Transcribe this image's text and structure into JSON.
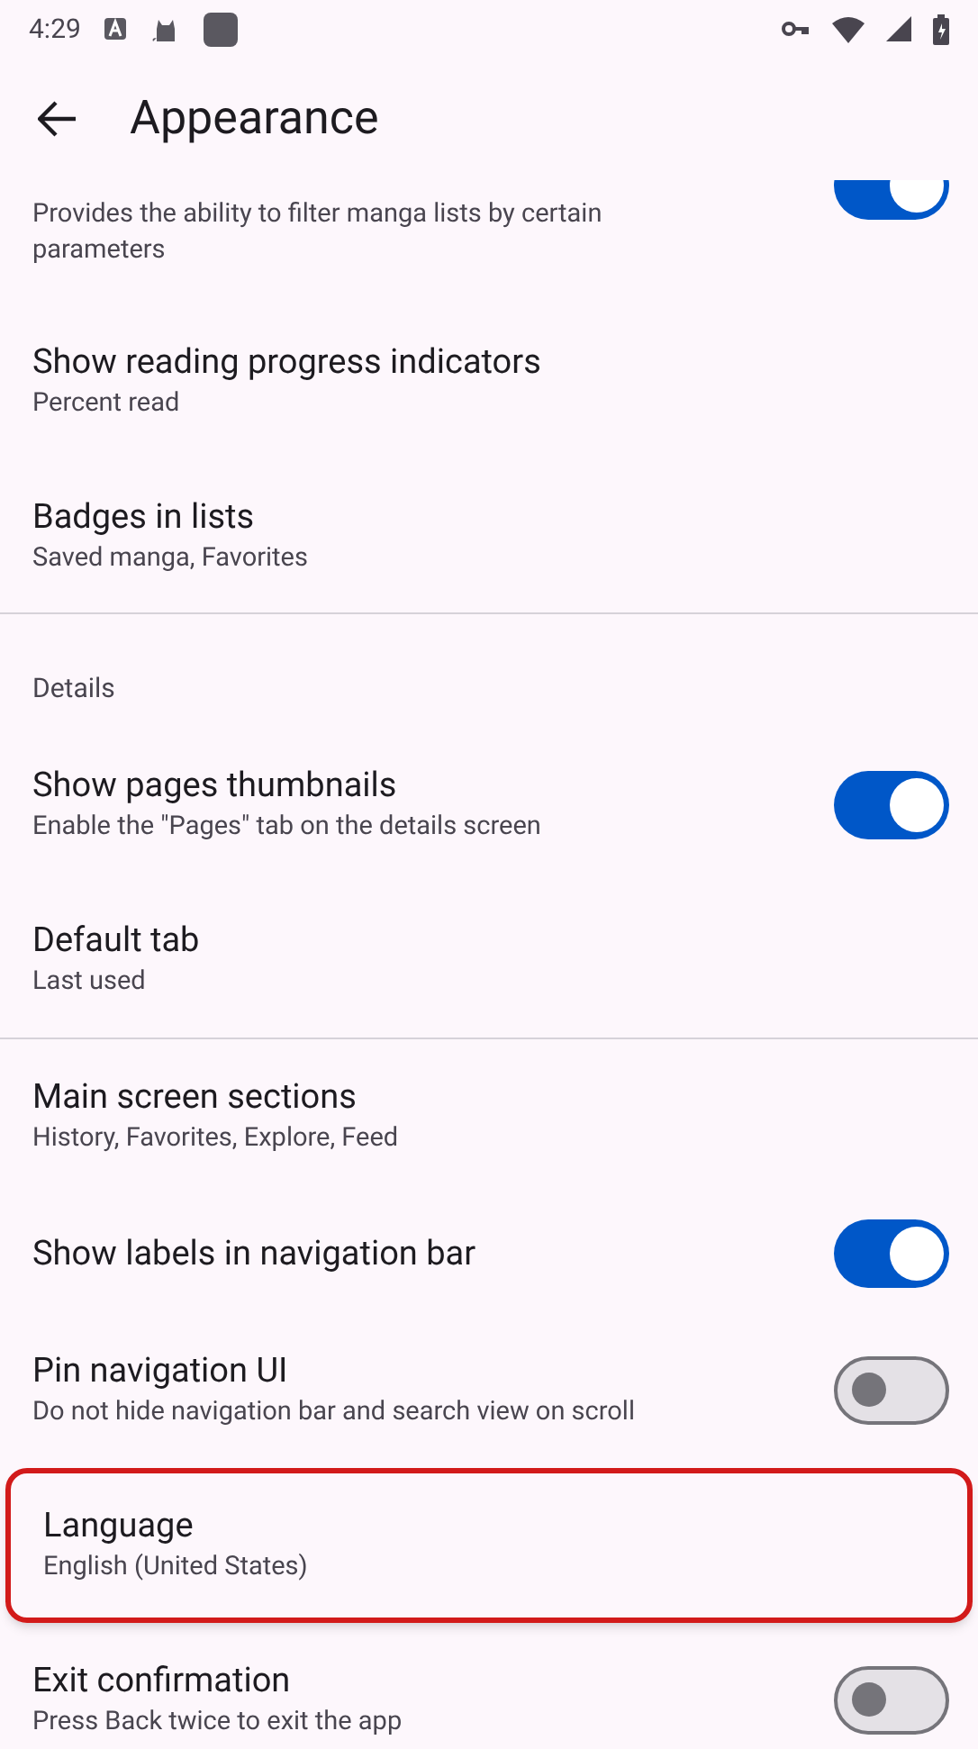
{
  "status_bar": {
    "time": "4:29"
  },
  "app_bar": {
    "title": "Appearance"
  },
  "sections": [
    {
      "items": [
        {
          "kind": "switch",
          "subtitle": "Provides the ability to filter manga lists by certain parameters",
          "on": true,
          "partial": true
        },
        {
          "kind": "plain",
          "title": "Show reading progress indicators",
          "subtitle": "Percent read"
        },
        {
          "kind": "plain",
          "title": "Badges in lists",
          "subtitle": "Saved manga, Favorites"
        }
      ]
    },
    {
      "header": "Details",
      "items": [
        {
          "kind": "switch",
          "title": "Show pages thumbnails",
          "subtitle": "Enable the \"Pages\" tab on the details screen",
          "on": true
        },
        {
          "kind": "plain",
          "title": "Default tab",
          "subtitle": "Last used"
        }
      ]
    },
    {
      "items": [
        {
          "kind": "plain",
          "title": "Main screen sections",
          "subtitle": "History, Favorites, Explore, Feed"
        },
        {
          "kind": "switch",
          "title": "Show labels in navigation bar",
          "on": true
        },
        {
          "kind": "switch",
          "title": "Pin navigation UI",
          "subtitle": "Do not hide navigation bar and search view on scroll",
          "on": false
        },
        {
          "kind": "plain",
          "title": "Language",
          "subtitle": "English (United States)",
          "highlighted": true
        },
        {
          "kind": "switch",
          "title": "Exit confirmation",
          "subtitle": "Press Back twice to exit the app",
          "on": false
        }
      ]
    }
  ]
}
